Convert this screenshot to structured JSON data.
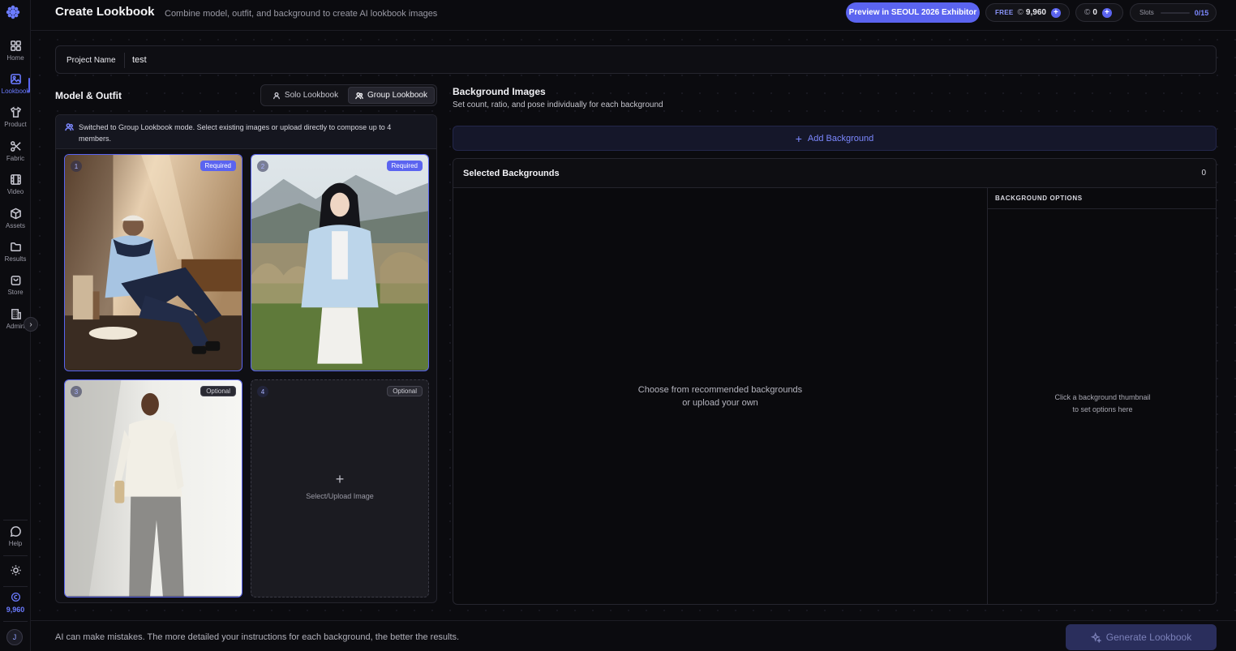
{
  "header": {
    "title": "Create Lookbook",
    "subtitle": "Combine model, outfit, and background to create AI lookbook images",
    "preview_button": "Preview in SEOUL 2026 Exhibitor",
    "free_label": "FREE",
    "credits": "9,960",
    "paid_credits": "0",
    "slots_label": "Slots",
    "slots_value": "0/15"
  },
  "sidebar": {
    "items": [
      {
        "label": "Home",
        "icon": "grid-icon"
      },
      {
        "label": "Lookbook",
        "icon": "image-icon",
        "active": true
      },
      {
        "label": "Product",
        "icon": "shirt-icon"
      },
      {
        "label": "Fabric",
        "icon": "scissors-icon"
      },
      {
        "label": "Video",
        "icon": "film-icon"
      },
      {
        "label": "Assets",
        "icon": "box-icon"
      },
      {
        "label": "Results",
        "icon": "folder-icon"
      },
      {
        "label": "Store",
        "icon": "bag-icon"
      },
      {
        "label": "Admin",
        "icon": "building-icon"
      }
    ],
    "help_label": "Help",
    "credits": "9,960",
    "avatar_initial": "J"
  },
  "project": {
    "label": "Project Name",
    "value": "test"
  },
  "model_outfit": {
    "title": "Model & Outfit",
    "solo_label": "Solo Lookbook",
    "group_label": "Group Lookbook",
    "selected_mode": "Group Lookbook",
    "notice": "Switched to Group Lookbook mode. Select existing images or upload directly to compose up to 4 members.",
    "slots": [
      {
        "number": "1",
        "badge": "Required",
        "filled": true
      },
      {
        "number": "2",
        "badge": "Required",
        "filled": true
      },
      {
        "number": "3",
        "badge": "Optional",
        "filled": true
      },
      {
        "number": "4",
        "badge": "Optional",
        "filled": false,
        "upload_label": "Select/Upload Image"
      }
    ]
  },
  "backgrounds": {
    "title": "Background Images",
    "subtitle": "Set count, ratio, and pose individually for each background",
    "add_label": "Add Background",
    "selected_title": "Selected Backgrounds",
    "selected_count": "0",
    "empty_line1": "Choose from recommended backgrounds",
    "empty_line2": "or upload your own",
    "options_title": "BACKGROUND OPTIONS",
    "options_line1": "Click a background thumbnail",
    "options_line2": "to set options here"
  },
  "footer": {
    "note": "AI can make mistakes. The more detailed your instructions for each background, the better the results.",
    "generate_label": "Generate Lookbook"
  },
  "colors": {
    "accent": "#5b64f0",
    "background": "#0b0b0f"
  }
}
